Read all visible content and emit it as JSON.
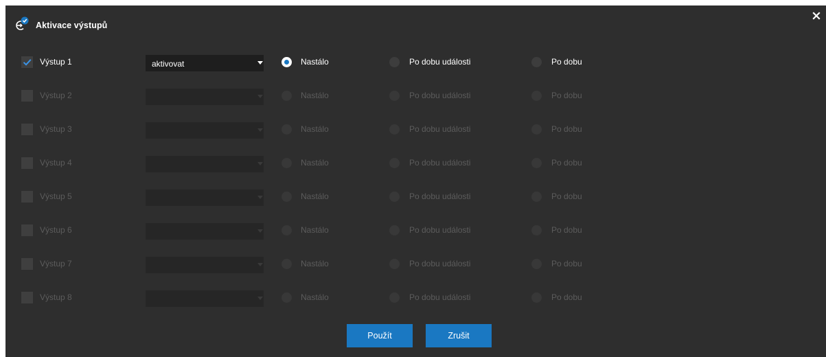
{
  "dialog": {
    "title": "Aktivace výstupů",
    "accent_color": "#1a78c2",
    "icons": {
      "title": "output-activation-icon",
      "close": "close-icon"
    }
  },
  "outputs": [
    {
      "label": "Výstup 1",
      "checked": true,
      "action": "aktivovat",
      "mode": "Nastálo"
    },
    {
      "label": "Výstup 2",
      "checked": false,
      "action": "",
      "mode": ""
    },
    {
      "label": "Výstup 3",
      "checked": false,
      "action": "",
      "mode": ""
    },
    {
      "label": "Výstup 4",
      "checked": false,
      "action": "",
      "mode": ""
    },
    {
      "label": "Výstup 5",
      "checked": false,
      "action": "",
      "mode": ""
    },
    {
      "label": "Výstup 6",
      "checked": false,
      "action": "",
      "mode": ""
    },
    {
      "label": "Výstup 7",
      "checked": false,
      "action": "",
      "mode": ""
    },
    {
      "label": "Výstup 8",
      "checked": false,
      "action": "",
      "mode": ""
    }
  ],
  "modes": {
    "permanent": "Nastálo",
    "event_duration": "Po dobu události",
    "duration": "Po dobu"
  },
  "buttons": {
    "apply": "Použít",
    "cancel": "Zrušit"
  }
}
